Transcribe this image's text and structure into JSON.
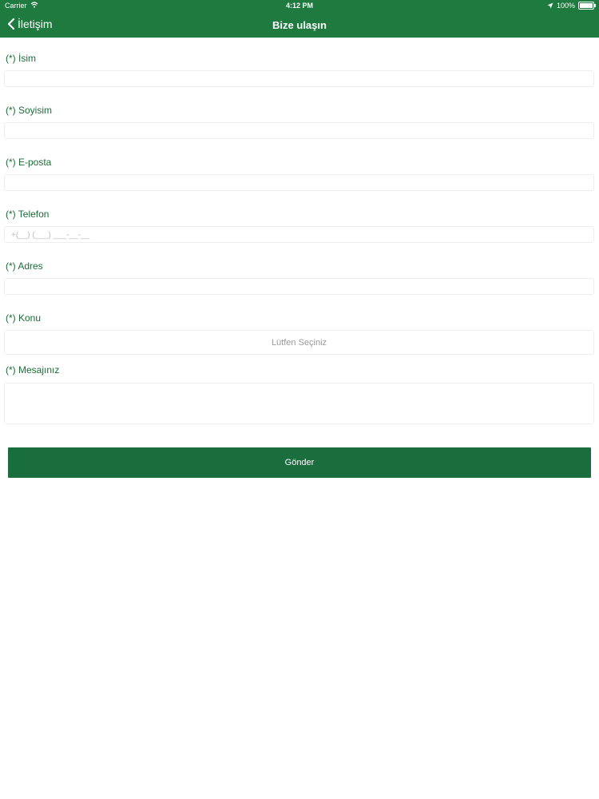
{
  "status_bar": {
    "carrier": "Carrier",
    "time": "4:12 PM",
    "battery": "100%"
  },
  "nav": {
    "back_label": "İletişim",
    "title": "Bize ulaşın"
  },
  "form": {
    "fields": [
      {
        "label": "(*) İsim",
        "value": ""
      },
      {
        "label": "(*) Soyisim",
        "value": ""
      },
      {
        "label": "(*) E-posta",
        "value": ""
      },
      {
        "label": "(*) Telefon",
        "placeholder": "+(__) (___) ___-__-__"
      },
      {
        "label": "(*) Adres",
        "value": ""
      },
      {
        "label": "(*) Konu",
        "select_value": "Lütfen Seçiniz"
      },
      {
        "label": "(*) Mesajınız",
        "value": ""
      }
    ],
    "submit_label": "Gönder"
  },
  "colors": {
    "primary": "#1e7a3e",
    "label": "#1e6b3a"
  },
  "icons": [
    "back-chevron-icon",
    "wifi-icon",
    "location-arrow-icon",
    "battery-icon"
  ]
}
